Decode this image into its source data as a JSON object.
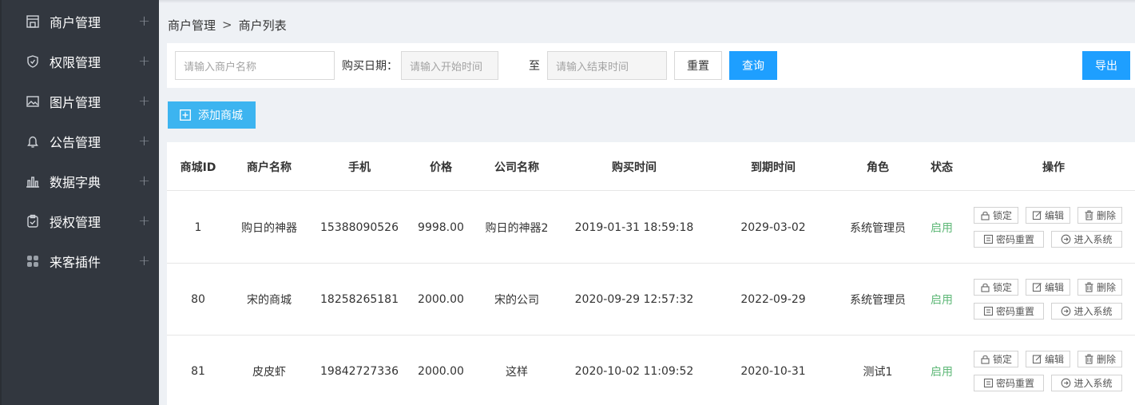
{
  "sidebar": {
    "items": [
      {
        "label": "商户管理",
        "icon": "store-icon"
      },
      {
        "label": "权限管理",
        "icon": "shield-icon"
      },
      {
        "label": "图片管理",
        "icon": "image-icon"
      },
      {
        "label": "公告管理",
        "icon": "bell-icon"
      },
      {
        "label": "数据字典",
        "icon": "bar-chart-icon"
      },
      {
        "label": "授权管理",
        "icon": "clipboard-check-icon"
      },
      {
        "label": "来客插件",
        "icon": "grid-icon"
      }
    ],
    "expand_symbol": "+"
  },
  "breadcrumb": {
    "parent": "商户管理",
    "separator": ">",
    "current": "商户列表"
  },
  "filter": {
    "name_placeholder": "请输入商户名称",
    "date_label": "购买日期：",
    "start_placeholder": "请输入开始时间",
    "to_label": "至",
    "end_placeholder": "请输入结束时间",
    "reset_label": "重置",
    "query_label": "查询",
    "export_label": "导出"
  },
  "add_button_label": "添加商城",
  "table": {
    "headers": [
      "商城ID",
      "商户名称",
      "手机",
      "价格",
      "公司名称",
      "购买时间",
      "到期时间",
      "角色",
      "状态",
      "操作"
    ],
    "rows": [
      {
        "id": "1",
        "name": "购日的神器",
        "phone": "15388090526",
        "price": "9998.00",
        "company": "购日的神器2",
        "buy_time": "2019-01-31 18:59:18",
        "expire": "2029-03-02",
        "role": "系统管理员",
        "status": "启用"
      },
      {
        "id": "80",
        "name": "宋的商城",
        "phone": "18258265181",
        "price": "2000.00",
        "company": "宋的公司",
        "buy_time": "2020-09-29 12:57:32",
        "expire": "2022-09-29",
        "role": "系统管理员",
        "status": "启用"
      },
      {
        "id": "81",
        "name": "皮皮虾",
        "phone": "19842727336",
        "price": "2000.00",
        "company": "这样",
        "buy_time": "2020-10-02 11:09:52",
        "expire": "2020-10-31",
        "role": "测试1",
        "status": "启用"
      }
    ],
    "actions": {
      "lock": "锁定",
      "edit": "编辑",
      "delete": "删除",
      "reset_password": "密码重置",
      "enter_system": "进入系统"
    }
  },
  "colors": {
    "sidebar_bg": "#32373f",
    "primary": "#1e9fff",
    "add_button": "#3cb4f0",
    "status_green": "#5fb878"
  }
}
